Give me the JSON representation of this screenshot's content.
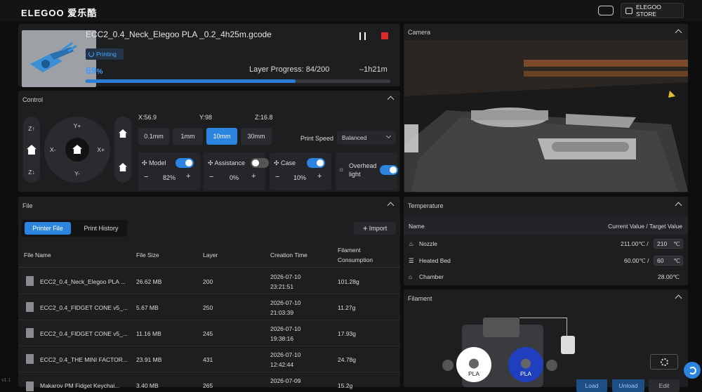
{
  "app": {
    "logo": "ELEGOO 爱乐酷",
    "store_label": "ELEGOO STORE"
  },
  "job": {
    "filename": "ECC2_0.4_Neck_Elegoo PLA _0.2_4h25m.gcode",
    "status": "Printing",
    "progress_value": "69",
    "progress_unit": "%",
    "progress_fraction": 0.69,
    "layer_label": "Layer Progress:",
    "layer_value": "84/200",
    "eta": "–1h21m"
  },
  "control": {
    "title": "Control",
    "coords": {
      "x": "X:56.9",
      "y": "Y:98",
      "z": "Z:16.8"
    },
    "z_up": "Z↑",
    "z_down": "Z↓",
    "y_plus": "Y+",
    "y_minus": "Y-",
    "x_minus": "X-",
    "x_plus": "X+",
    "steps": [
      "0.1mm",
      "1mm",
      "10mm",
      "30mm"
    ],
    "active_step": "10mm",
    "speed_label": "Print Speed",
    "speed_value": "Balanced",
    "fans": [
      {
        "label": "Model",
        "value": "82%",
        "on": true
      },
      {
        "label": "Assistance",
        "value": "0%",
        "on": false
      },
      {
        "label": "Case",
        "value": "10%",
        "on": true
      }
    ],
    "light_label_1": "Overhead",
    "light_label_2": "light",
    "minus": "−",
    "plus": "+"
  },
  "file": {
    "title": "File",
    "tabs": [
      "Printer File",
      "Print History"
    ],
    "import_label": "Import",
    "columns": [
      "File Name",
      "File Size",
      "Layer",
      "Creation Time",
      "Filament",
      "Consumption"
    ],
    "rows": [
      {
        "name": "ECC2_0.4_Neck_Elegoo PLA ...",
        "size": "26.62 MB",
        "layer": "200",
        "date": "2026-07-10",
        "time": "23:21:51",
        "filament": "101.28g"
      },
      {
        "name": "ECC2_0.4_FIDGET CONE v5_...",
        "size": "5.67 MB",
        "layer": "250",
        "date": "2026-07-10",
        "time": "21:03:39",
        "filament": "11.27g"
      },
      {
        "name": "ECC2_0.4_FIDGET CONE v5_...",
        "size": "11.16 MB",
        "layer": "245",
        "date": "2026-07-10",
        "time": "19:38:16",
        "filament": "17.93g"
      },
      {
        "name": "ECC2_0.4_THE MINI FACTOR...",
        "size": "23.91 MB",
        "layer": "431",
        "date": "2026-07-10",
        "time": "12:42:44",
        "filament": "24.78g"
      },
      {
        "name": "Makarov PM Fidget Keychai...",
        "size": "3.40 MB",
        "layer": "265",
        "date": "2026-07-09",
        "time": "",
        "filament": "15.2g"
      }
    ]
  },
  "camera": {
    "title": "Camera"
  },
  "temperature": {
    "title": "Temperature",
    "col_name": "Name",
    "col_value": "Current Value / Target Value",
    "rows": [
      {
        "name": "Nozzle",
        "current": "211.00℃ /",
        "target": "210",
        "unit": "℃"
      },
      {
        "name": "Heated Bed",
        "current": "60.00℃ /",
        "target": "60",
        "unit": "℃"
      },
      {
        "name": "Chamber",
        "current": "28.00℃",
        "target": "",
        "unit": ""
      }
    ]
  },
  "filament": {
    "title": "Filament",
    "spools": [
      {
        "label": "PLA",
        "color": "#ffffff"
      },
      {
        "label": "PLA",
        "color": "#1f3fbf"
      }
    ],
    "buttons": [
      "Load",
      "Unload",
      "Edit"
    ]
  },
  "version": "v1.1"
}
